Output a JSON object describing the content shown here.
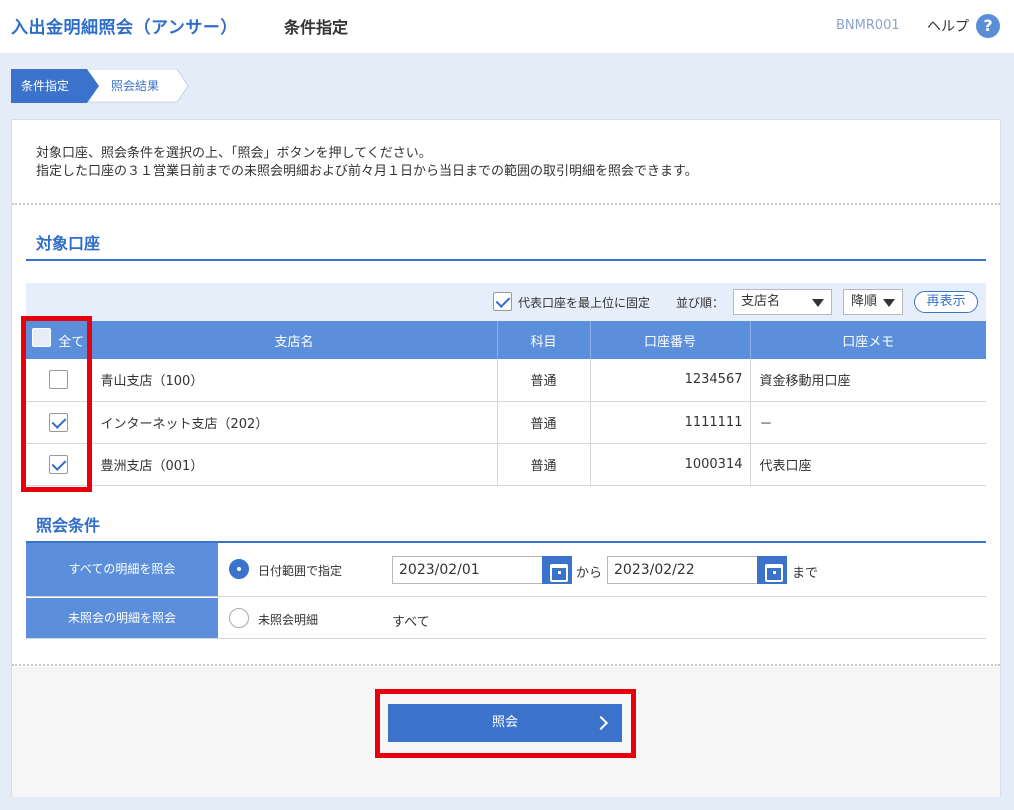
{
  "header": {
    "app_title": "入出金明細照会（アンサー）",
    "page_title": "条件指定",
    "screen_id": "BNMR001",
    "help_label": "ヘルプ",
    "help_icon": "?"
  },
  "steps": [
    {
      "label": "条件指定",
      "active": true
    },
    {
      "label": "照会結果",
      "active": false
    }
  ],
  "intro": {
    "line1": "対象口座、照会条件を選択の上、「照会」ボタンを押してください。",
    "line2": "指定した口座の３１営業日前までの未照会明細および前々月１日から当日までの範囲の取引明細を照会できます。"
  },
  "accounts_section": {
    "title": "対象口座",
    "pin_representative_label": "代表口座を最上位に固定",
    "pin_representative_checked": true,
    "sort_label": "並び順：",
    "sort_field": "支店名",
    "sort_order": "降順",
    "redisplay_label": "再表示",
    "columns": {
      "all": "全て",
      "branch": "支店名",
      "type": "科目",
      "number": "口座番号",
      "memo": "口座メモ"
    },
    "rows": [
      {
        "checked": false,
        "branch": "青山支店（100）",
        "type": "普通",
        "number": "1234567",
        "memo": "資金移動用口座"
      },
      {
        "checked": true,
        "branch": "インターネット支店（202）",
        "type": "普通",
        "number": "1111111",
        "memo": "－"
      },
      {
        "checked": true,
        "branch": "豊洲支店（001）",
        "type": "普通",
        "number": "1000314",
        "memo": "代表口座"
      }
    ]
  },
  "conditions_section": {
    "title": "照会条件",
    "all_label": "すべての明細を照会",
    "date_range_option": "日付範囲で指定",
    "date_from": "2023/02/01",
    "from_suffix": "から",
    "date_to": "2023/02/22",
    "to_suffix": "まで",
    "unread_label": "未照会の明細を照会",
    "unread_option": "未照会明細",
    "unread_value": "すべて"
  },
  "submit": {
    "label": "照会"
  },
  "colors": {
    "accent": "#3b73cc",
    "header_blue": "#5b8fdc",
    "highlight": "#e8000b"
  }
}
